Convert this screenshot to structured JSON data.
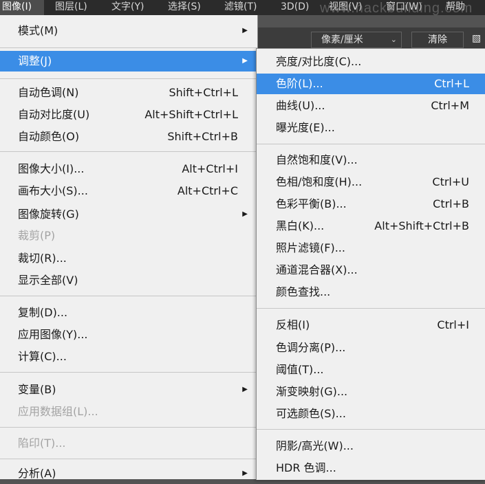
{
  "menubar": {
    "items": [
      "图像(I)",
      "图层(L)",
      "文字(Y)",
      "选择(S)",
      "滤镜(T)",
      "3D(D)",
      "视图(V)",
      "窗口(W)",
      "帮助"
    ]
  },
  "watermark": "www.hackbuilding.com",
  "options_bar": {
    "unit_select": "像素/厘米",
    "clear_button": "清除"
  },
  "image_menu": {
    "items": [
      {
        "label": "模式(M)",
        "submenu": true
      },
      {
        "label": "调整(J)",
        "submenu": true,
        "highlighted": true
      },
      {
        "label": "自动色调(N)",
        "shortcut": "Shift+Ctrl+L"
      },
      {
        "label": "自动对比度(U)",
        "shortcut": "Alt+Shift+Ctrl+L"
      },
      {
        "label": "自动颜色(O)",
        "shortcut": "Shift+Ctrl+B"
      },
      {
        "label": "图像大小(I)...",
        "shortcut": "Alt+Ctrl+I"
      },
      {
        "label": "画布大小(S)...",
        "shortcut": "Alt+Ctrl+C"
      },
      {
        "label": "图像旋转(G)",
        "submenu": true
      },
      {
        "label": "裁剪(P)",
        "disabled": true
      },
      {
        "label": "裁切(R)..."
      },
      {
        "label": "显示全部(V)"
      },
      {
        "label": "复制(D)..."
      },
      {
        "label": "应用图像(Y)..."
      },
      {
        "label": "计算(C)..."
      },
      {
        "label": "变量(B)",
        "submenu": true
      },
      {
        "label": "应用数据组(L)...",
        "disabled": true
      },
      {
        "label": "陷印(T)...",
        "disabled": true
      },
      {
        "label": "分析(A)",
        "submenu": true
      }
    ]
  },
  "adjust_menu": {
    "items": [
      {
        "label": "亮度/对比度(C)..."
      },
      {
        "label": "色阶(L)...",
        "shortcut": "Ctrl+L",
        "highlighted": true
      },
      {
        "label": "曲线(U)...",
        "shortcut": "Ctrl+M"
      },
      {
        "label": "曝光度(E)..."
      },
      {
        "label": "自然饱和度(V)..."
      },
      {
        "label": "色相/饱和度(H)...",
        "shortcut": "Ctrl+U"
      },
      {
        "label": "色彩平衡(B)...",
        "shortcut": "Ctrl+B"
      },
      {
        "label": "黑白(K)...",
        "shortcut": "Alt+Shift+Ctrl+B"
      },
      {
        "label": "照片滤镜(F)..."
      },
      {
        "label": "通道混合器(X)..."
      },
      {
        "label": "颜色查找..."
      },
      {
        "label": "反相(I)",
        "shortcut": "Ctrl+I"
      },
      {
        "label": "色调分离(P)..."
      },
      {
        "label": "阈值(T)..."
      },
      {
        "label": "渐变映射(G)..."
      },
      {
        "label": "可选颜色(S)..."
      },
      {
        "label": "阴影/高光(W)..."
      },
      {
        "label": "HDR 色调..."
      }
    ]
  },
  "colors": {
    "highlight": "#3b8de6",
    "menu_bg": "#f0f0f0",
    "menubar_bg": "#2b2b2b"
  }
}
